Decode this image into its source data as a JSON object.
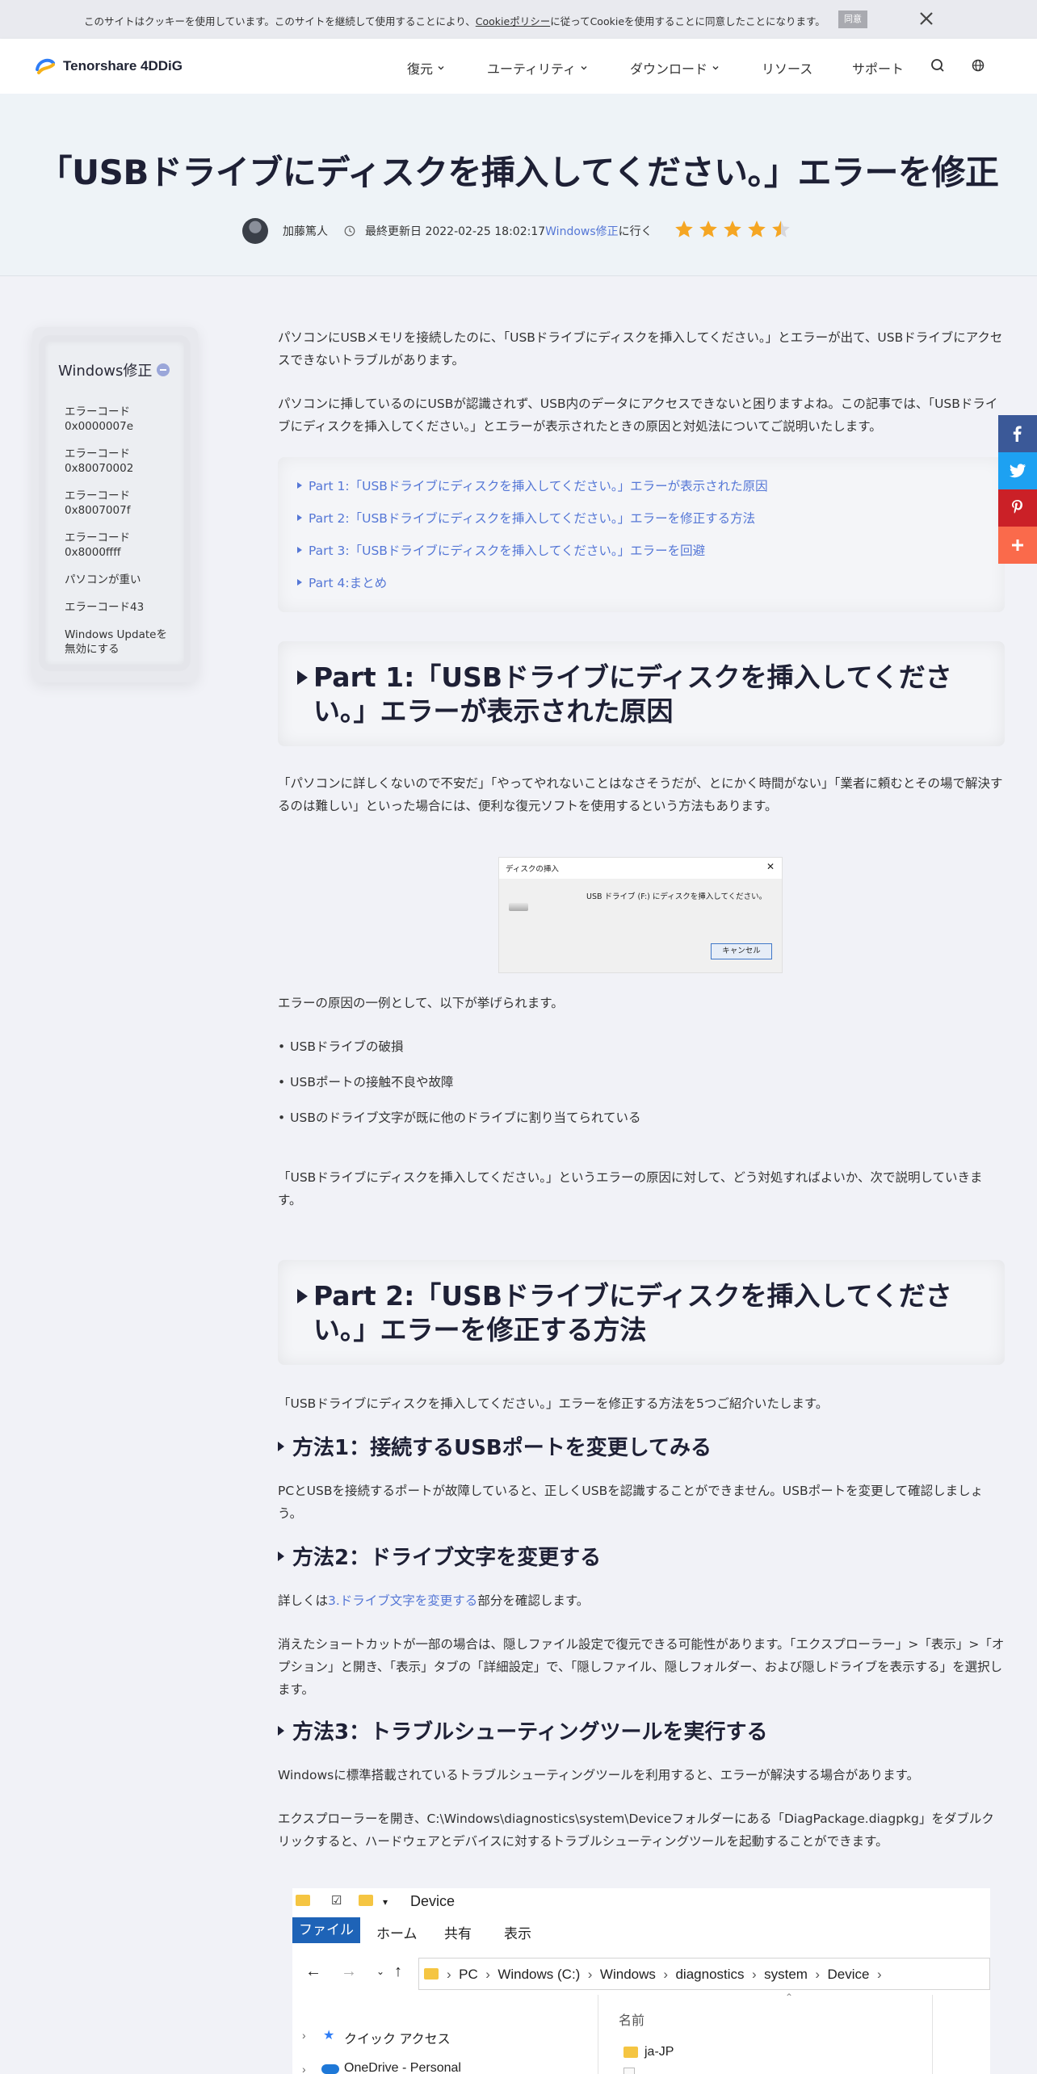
{
  "cookie": {
    "text_before": "このサイトはクッキーを使用しています。このサイトを継続して使用することにより、",
    "policy_link": "Cookieポリシー",
    "text_after": "に従ってCookieを使用することに同意したことになります。",
    "agree": "同意"
  },
  "header": {
    "brand": "Tenorshare 4DDiG",
    "nav": [
      "復元",
      "ユーティリティ",
      "ダウンロード",
      "リソース",
      "サポート"
    ]
  },
  "hero": {
    "title": "「USBドライブにディスクを挿入してください。」エラーを修正",
    "author": "加藤篤人",
    "updated": "最終更新日 2022-02-25 18:02:17",
    "category_link": "Windows修正",
    "category_suffix": "に行く",
    "rating": 4.5
  },
  "sidebar": {
    "title": "Windows修正",
    "items": [
      "エラーコード 0x0000007e",
      "エラーコード 0x80070002",
      "エラーコード 0x8007007f",
      "エラーコード 0x8000ffff",
      "パソコンが重い",
      "エラーコード43",
      "Windows Updateを無効にする"
    ]
  },
  "article": {
    "intro1": "パソコンにUSBメモリを接続したのに、「USBドライブにディスクを挿入してください。」とエラーが出て、USBドライブにアクセスできないトラブルがあります。",
    "intro2": "パソコンに挿しているのにUSBが認識されず、USB内のデータにアクセスできないと困りますよね。この記事では、「USBドライブにディスクを挿入してください。」とエラーが表示されたときの原因と対処法についてご説明いたします。",
    "toc": [
      "Part 1:「USBドライブにディスクを挿入してください。」エラーが表示された原因",
      "Part 2:「USBドライブにディスクを挿入してください。」エラーを修正する方法",
      "Part 3:「USBドライブにディスクを挿入してください。」エラーを回避",
      "Part 4:まとめ"
    ],
    "part1_heading": "Part 1:「USBドライブにディスクを挿入してください。」エラーが表示された原因",
    "part1_p": "「パソコンに詳しくないので不安だ」「やってやれないことはなさそうだが、とにかく時間がない」「業者に頼むとその場で解決するのは難しい」といった場合には、便利な復元ソフトを使用するという方法もあります。",
    "dialog": {
      "title": "ディスクの挿入",
      "message": "USB ドライブ (F:) にディスクを挿入してください。",
      "button": "キャンセル"
    },
    "causes_intro": "エラーの原因の一例として、以下が挙げられます。",
    "causes": [
      "USBドライブの破損",
      "USBポートの接触不良や故障",
      "USBのドライブ文字が既に他のドライブに割り当てられている"
    ],
    "causes_outro": "「USBドライブにディスクを挿入してください。」というエラーの原因に対して、どう対処すればよいか、次で説明していきます。",
    "part2_heading": "Part 2:「USBドライブにディスクを挿入してください。」エラーを修正する方法",
    "part2_intro": "「USBドライブにディスクを挿入してください。」エラーを修正する方法を5つご紹介いたします。",
    "method1_heading": "方法1：接続するUSBポートを変更してみる",
    "method1_p": "PCとUSBを接続するポートが故障していると、正しくUSBを認識することができません。USBポートを変更して確認しましょう。",
    "method2_heading": "方法2：ドライブ文字を変更する",
    "method2_p_before": "詳しくは",
    "method2_link": "3.ドライブ文字を変更する",
    "method2_p_after": "部分を確認します。",
    "method2_p2": "消えたショートカットが一部の場合は、隠しファイル設定で復元できる可能性があります。「エクスプローラー」>「表示」>「オプション」と開き、「表示」タブの「詳細設定」で、「隠しファイル、隠しフォルダー、および隠しドライブを表示する」を選択します。",
    "method3_heading": "方法3：トラブルシューティングツールを実行する",
    "method3_p1": "Windowsに標準搭載されているトラブルシューティングツールを利用すると、エラーが解決する場合があります。",
    "method3_p2": "エクスプローラーを開き、C:\\Windows\\diagnostics\\system\\Deviceフォルダーにある「DiagPackage.diagpkg」をダブルクリックすると、ハードウェアとデバイスに対するトラブルシューティングツールを起動することができます。",
    "explorer": {
      "title": "Device",
      "tabs": [
        "ファイル",
        "ホーム",
        "共有",
        "表示"
      ],
      "path": [
        "PC",
        "Windows (C:)",
        "Windows",
        "diagnostics",
        "system",
        "Device"
      ],
      "nav_items": [
        "クイック アクセス",
        "OneDrive - Personal"
      ],
      "column": "名前",
      "files": [
        "ja-JP"
      ]
    }
  }
}
